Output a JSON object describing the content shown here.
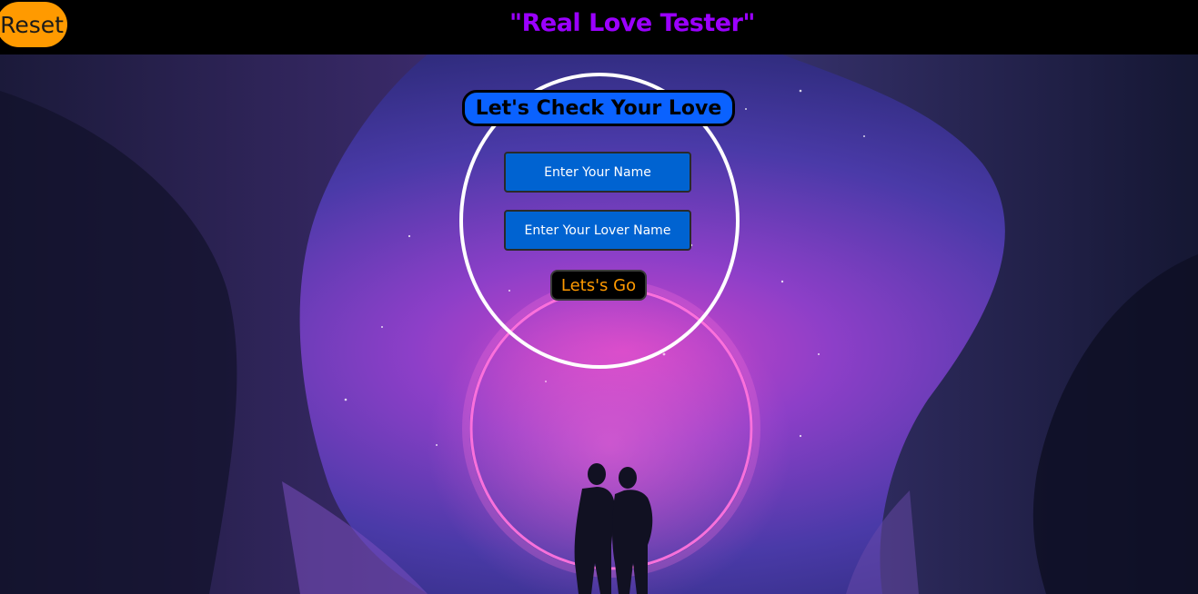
{
  "header": {
    "reset_label": "Reset",
    "title": "\"Real Love Tester\""
  },
  "form": {
    "heading": "Let's Check Your Love",
    "your_name_placeholder": "Enter Your Name",
    "lover_name_placeholder": "Enter Your Lover Name",
    "submit_label": "Lets's Go"
  },
  "colors": {
    "reset_bg": "#ff9a00",
    "title": "#9b00ff",
    "heading_bg": "#0a62ff",
    "input_bg": "#0063d1",
    "go_text": "#ff9a00"
  },
  "background": {
    "description_icon": "couple-under-neon-ring-scene"
  }
}
